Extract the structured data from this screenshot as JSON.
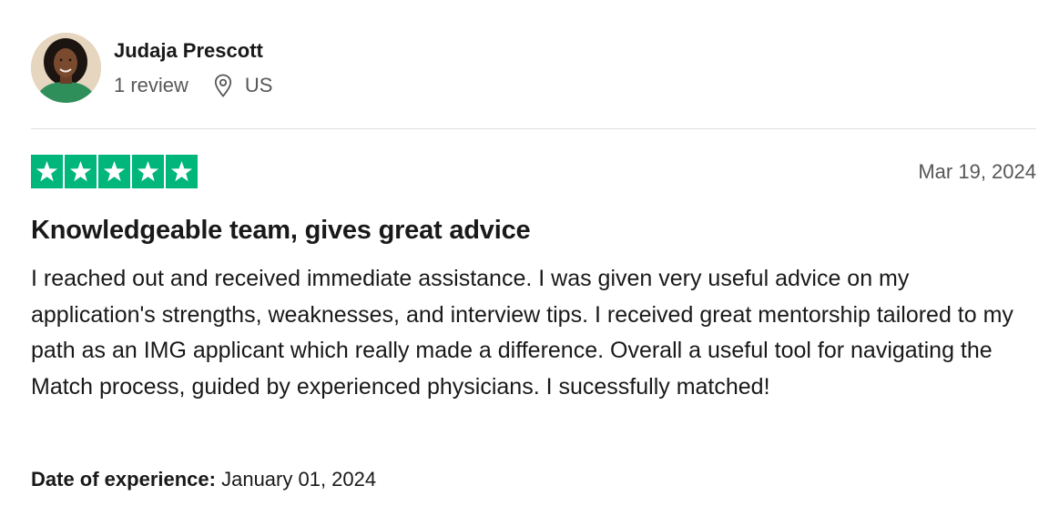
{
  "reviewer": {
    "name": "Judaja Prescott",
    "review_count": "1 review",
    "country": "US"
  },
  "review": {
    "rating": 5,
    "max_rating": 5,
    "star_color": "#00b67a",
    "date": "Mar 19, 2024",
    "title": "Knowledgeable team, gives great advice",
    "body": "I reached out and received immediate assistance. I was given very useful advice on my application's strengths, weaknesses, and interview tips. I received great mentorship tailored to my path as an IMG applicant which really made a difference. Overall a useful tool for navigating the Match process, guided by experienced physicians. I sucessfully matched!",
    "experience_label": "Date of experience:",
    "experience_date": "January 01, 2024"
  },
  "icons": {
    "location": "location-pin-icon",
    "star": "star-icon"
  }
}
